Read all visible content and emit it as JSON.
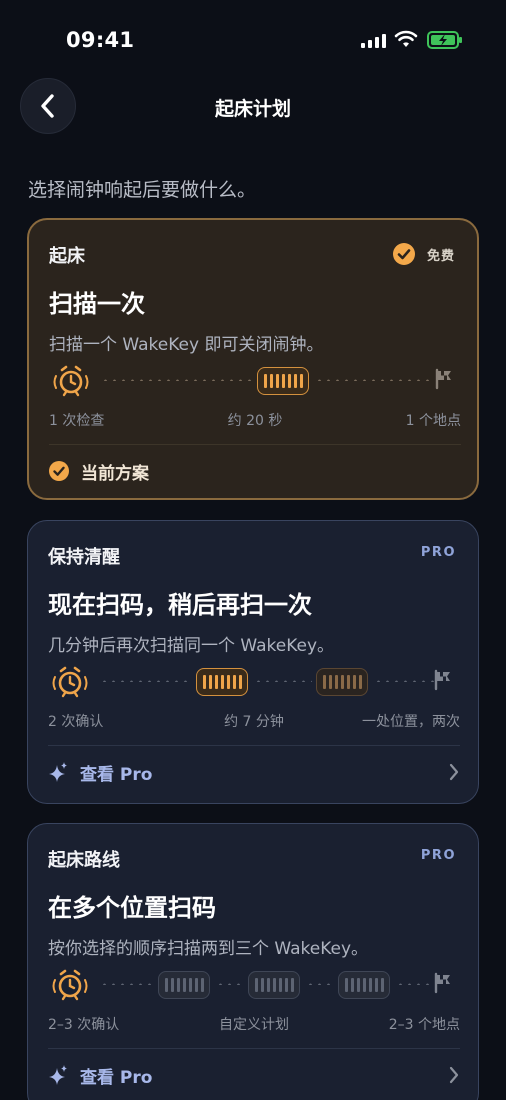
{
  "status_bar": {
    "time": "09:41"
  },
  "nav": {
    "title": "起床计划"
  },
  "subtitle": "选择闹钟响起后要做什么。",
  "cards": [
    {
      "kicker": "起床",
      "badge": "免费",
      "headline": "扫描一次",
      "description": "扫描一个 WakeKey 即可关闭闹钟。",
      "meta": [
        "1 次检查",
        "约 20 秒",
        "1 个地点"
      ],
      "footer": "当前方案",
      "selected": true
    },
    {
      "kicker": "保持清醒",
      "badge": "PRO",
      "headline": "现在扫码，稍后再扫一次",
      "description": "几分钟后再次扫描同一个 WakeKey。",
      "meta": [
        "2 次确认",
        "约 7 分钟",
        "一处位置，两次"
      ],
      "footer": "查看 Pro"
    },
    {
      "kicker": "起床路线",
      "badge": "PRO",
      "headline": "在多个位置扫码",
      "description": "按你选择的顺序扫描两到三个 WakeKey。",
      "meta": [
        "2–3 次确认",
        "自定义计划",
        "2–3 个地点"
      ],
      "footer": "查看 Pro"
    }
  ],
  "colors": {
    "accent": "#f0a54a",
    "pro": "#8fa3d8",
    "background": "#0c0f17"
  },
  "icons": [
    "chevron-left-icon",
    "alarm-clock-icon",
    "flag-icon",
    "check-icon",
    "sparkle-icon",
    "chevron-right-icon"
  ]
}
